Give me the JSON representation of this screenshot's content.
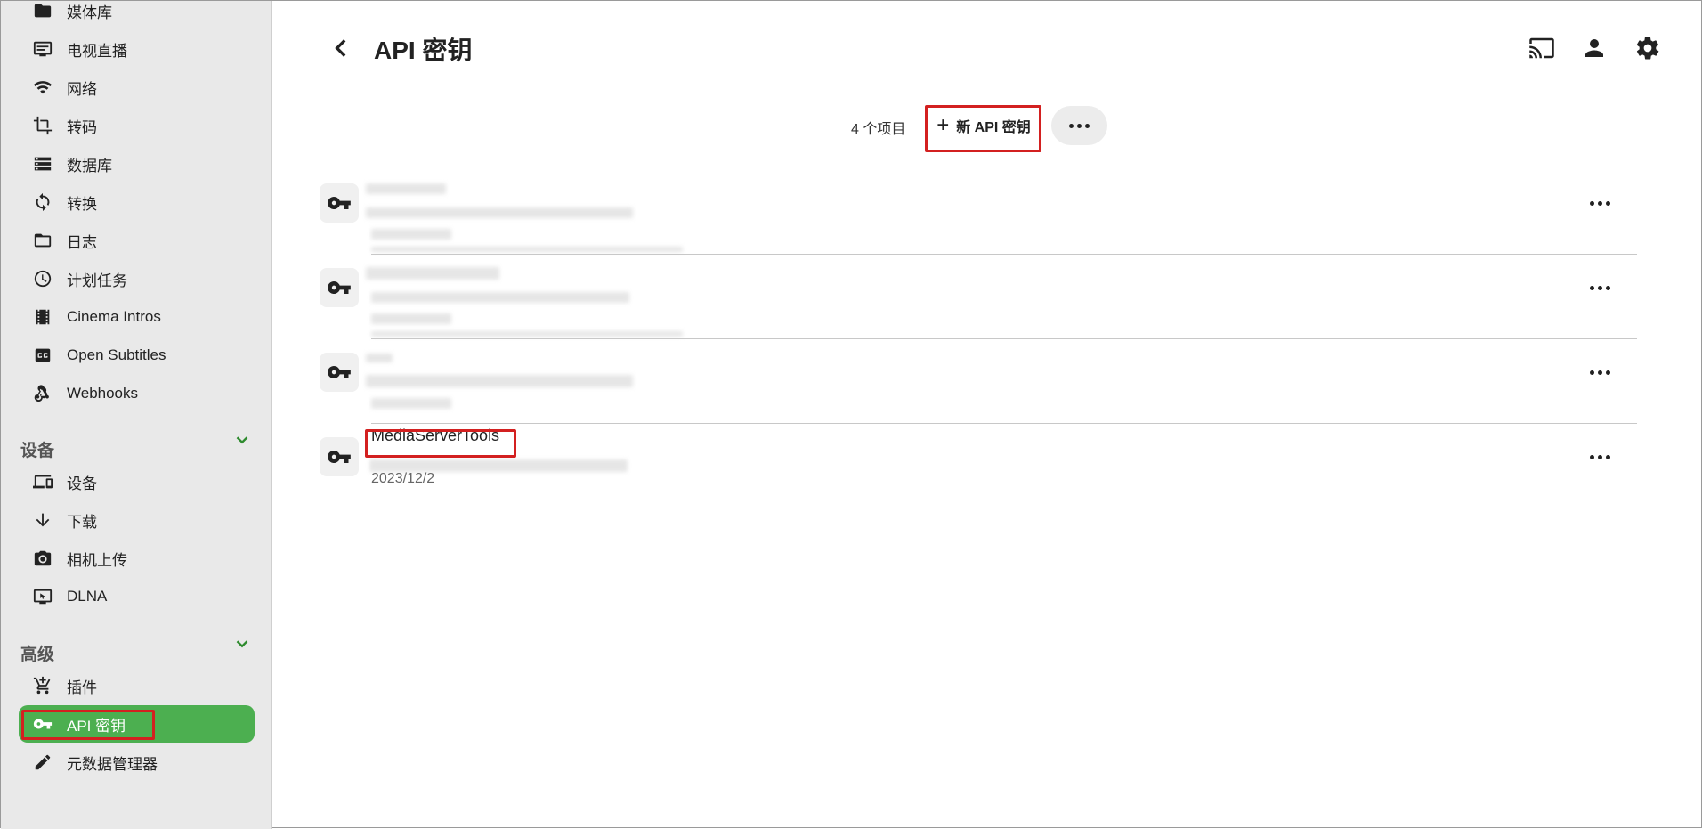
{
  "sidebar": {
    "items": [
      {
        "label": "媒体库",
        "icon": "folder-icon"
      },
      {
        "label": "电视直播",
        "icon": "tv-icon"
      },
      {
        "label": "网络",
        "icon": "wifi-icon"
      },
      {
        "label": "转码",
        "icon": "crop-icon"
      },
      {
        "label": "数据库",
        "icon": "database-icon"
      },
      {
        "label": "转换",
        "icon": "sync-icon"
      },
      {
        "label": "日志",
        "icon": "folder-outline-icon"
      },
      {
        "label": "计划任务",
        "icon": "clock-icon"
      },
      {
        "label": "Cinema Intros",
        "icon": "film-icon"
      },
      {
        "label": "Open Subtitles",
        "icon": "closed-caption-icon"
      },
      {
        "label": "Webhooks",
        "icon": "webhook-icon"
      }
    ],
    "devices_section": {
      "title": "设备",
      "items": [
        {
          "label": "设备",
          "icon": "devices-icon"
        },
        {
          "label": "下载",
          "icon": "download-arrow-icon"
        },
        {
          "label": "相机上传",
          "icon": "camera-icon"
        },
        {
          "label": "DLNA",
          "icon": "dlna-icon"
        }
      ]
    },
    "advanced_section": {
      "title": "高级",
      "items": [
        {
          "label": "插件",
          "icon": "cart-plus-icon"
        },
        {
          "label": "API 密钥",
          "icon": "key-icon",
          "active": true
        },
        {
          "label": "元数据管理器",
          "icon": "pencil-icon"
        }
      ]
    }
  },
  "header": {
    "title": "API 密钥",
    "icons": [
      "cast-icon",
      "user-icon",
      "settings-icon"
    ]
  },
  "toolbar": {
    "count": "4 个项目",
    "new_button": "新 API 密钥"
  },
  "keys": [
    {
      "name": "",
      "date": "",
      "redacted": true
    },
    {
      "name": "",
      "date": "",
      "redacted": true
    },
    {
      "name": "",
      "date": "",
      "redacted": true
    },
    {
      "name": "MediaServerTools",
      "date": "2023/12/2",
      "redacted": false
    }
  ],
  "colors": {
    "accent": "#4caf50",
    "highlight": "#d32020",
    "sidebar_bg": "#e9e9e9"
  }
}
